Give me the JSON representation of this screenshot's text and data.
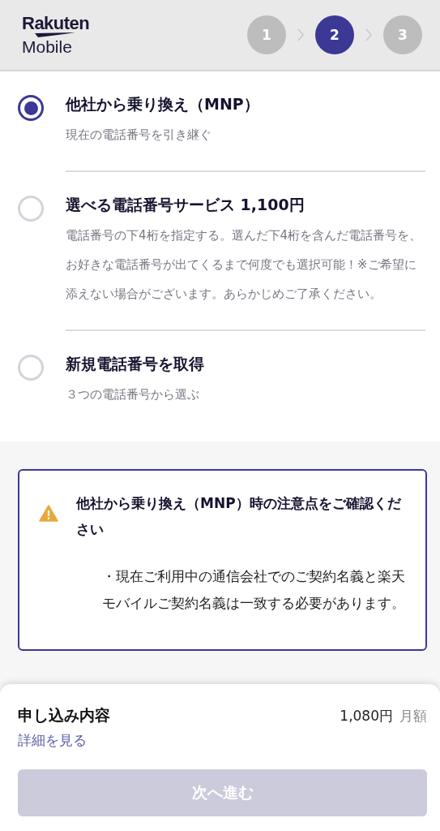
{
  "header": {
    "logo": {
      "brand": "Rakuten",
      "product": "Mobile"
    },
    "steps": [
      {
        "label": "1",
        "selected": false
      },
      {
        "label": "2",
        "selected": true
      },
      {
        "label": "3",
        "selected": false
      }
    ]
  },
  "options": [
    {
      "title": "他社から乗り換え（MNP）",
      "description": "現在の電話番号を引き継ぐ",
      "selected": true
    },
    {
      "title": "選べる電話番号サービス 1,100円",
      "description": "電話番号の下4桁を指定する。選んだ下4桁を含んだ電話番号を、お好きな電話番号が出てくるまで何度でも選択可能！※ご希望に添えない場合がございます。あらかじめご了承ください。",
      "selected": false
    },
    {
      "title": "新規電話番号を取得",
      "description": "３つの電話番号から選ぶ",
      "selected": false
    }
  ],
  "notice": {
    "title": "他社から乗り換え（MNP）時の注意点をご確認ください",
    "items": [
      "・現在ご利用中の通信会社でのご契約名義と楽天モバイルご契約名義は一致する必要があります。"
    ]
  },
  "summary": {
    "title": "申し込み内容",
    "details_link": "詳細を見る",
    "price": "1,080円",
    "period": "月額",
    "next_button": {
      "label": "次へ進む",
      "disabled": true
    }
  }
}
